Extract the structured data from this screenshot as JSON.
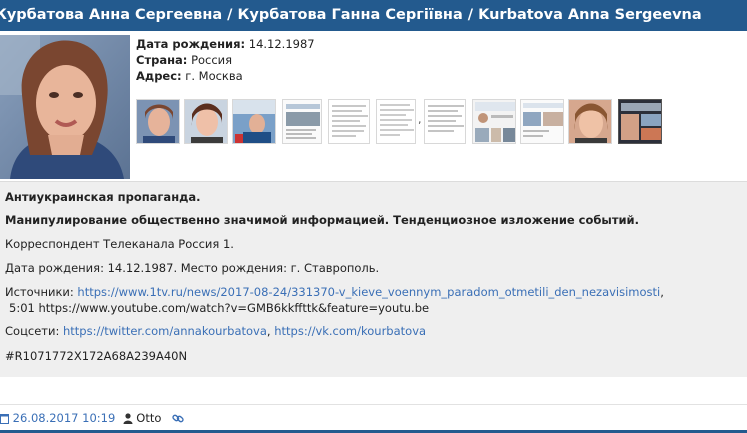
{
  "header": {
    "title": "Курбатова Анна Сергеевна / Курбатова Ганна Сергіївна / Kurbatova Anna Sergeevna"
  },
  "profile": {
    "birth_label": "Дата рождения:",
    "birth_value": "14.12.1987",
    "country_label": "Страна:",
    "country_value": "Россия",
    "address_label": "Адрес:",
    "address_value": "г. Москва",
    "thumbnail_separator": ","
  },
  "content": {
    "line1": "Антиукраинская пропаганда.",
    "line2": "Манипулирование общественно значимой информацией. Тенденциозное изложение событий.",
    "line3": "Корреспондент Телеканала Россия 1.",
    "line4": "Дата рождения: 14.12.1987. Место рождения: г. Ставрополь.",
    "sources_label": "Источники:",
    "source_link_1": "https://www.1tv.ru/news/2017-08-24/331370-v_kieve_voennym_paradom_otmetili_den_nezavisimosti",
    "source_link_1_suffix": ",",
    "source_line_2_prefix": "5:01",
    "source_line_2_text": "https://www.youtube.com/watch?v=GMB6kkffttk&feature=youtu.be",
    "social_label": "Соцсети:",
    "social_link_1": "https://twitter.com/annakourbatova",
    "social_separator": ",",
    "social_link_2": "https://vk.com/kourbatova",
    "hash": "#R1071772X172A68A239A40N"
  },
  "footer": {
    "date": "26.08.2017 10:19",
    "author": "Otto"
  },
  "colors": {
    "header_bg": "#235a8e",
    "link": "#3a6fb6",
    "content_bg": "#efefef"
  },
  "icons": {
    "date": "calendar-icon",
    "author": "user-icon",
    "permalink": "link-icon"
  }
}
